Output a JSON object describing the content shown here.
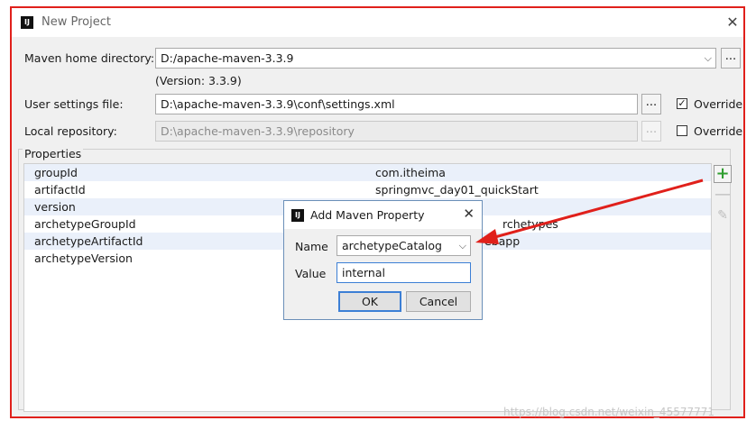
{
  "window": {
    "title": "New Project",
    "app_icon": "IJ"
  },
  "maven_home": {
    "label": "Maven home directory:",
    "value": "D:/apache-maven-3.3.9",
    "version": "(Version: 3.3.9)"
  },
  "user_settings": {
    "label": "User settings file:",
    "value": "D:\\apache-maven-3.3.9\\conf\\settings.xml",
    "override_label": "Override",
    "override_checked": true
  },
  "local_repo": {
    "label": "Local repository:",
    "value": "D:\\apache-maven-3.3.9\\repository",
    "override_label": "Override",
    "override_checked": false
  },
  "browse_label": "...",
  "properties": {
    "legend": "Properties",
    "rows": [
      {
        "key": "groupId",
        "value": "com.itheima"
      },
      {
        "key": "artifactId",
        "value": "springmvc_day01_quickStart"
      },
      {
        "key": "version",
        "value": ""
      },
      {
        "key": "archetypeGroupId",
        "value": "rchetypes"
      },
      {
        "key": "archetypeArtifactId",
        "value": "ebapp"
      },
      {
        "key": "archetypeVersion",
        "value": ""
      }
    ]
  },
  "dialog": {
    "title": "Add Maven Property",
    "app_icon": "IJ",
    "name_label": "Name",
    "name_value": "archetypeCatalog",
    "value_label": "Value",
    "value_value": "internal",
    "ok": "OK",
    "cancel": "Cancel"
  },
  "icons": {
    "close": "close-icon",
    "plus": "plus-icon",
    "minus": "minus-icon",
    "edit": "pencil-icon"
  },
  "colors": {
    "annotation": "#e0201b",
    "add_green": "#2f9e2f"
  },
  "watermark": "https://blog.csdn.net/weixin_45577771"
}
